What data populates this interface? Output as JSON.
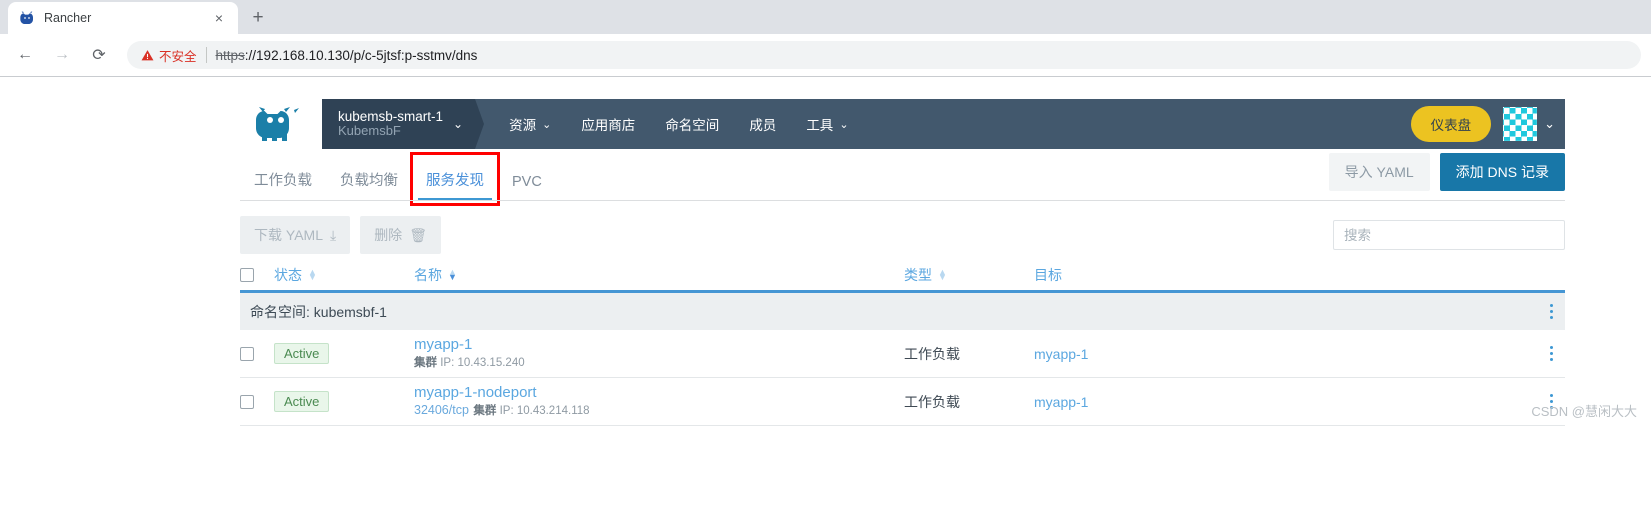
{
  "browser": {
    "tab": {
      "title": "Rancher",
      "favicon": "rancher-cow-icon",
      "close": "×"
    },
    "new_tab": "+",
    "back": "←",
    "forward": "→",
    "reload": "⟳",
    "security": {
      "icon": "warning-triangle-icon",
      "label": "不安全"
    },
    "url": {
      "scheme": "https",
      "rest": "://192.168.10.130/p/c-5jtsf:p-sstmv/dns"
    }
  },
  "header": {
    "logo": "rancher-logo-icon",
    "cluster": {
      "name": "kubemsb-smart-1",
      "project": "KubemsbF",
      "chevron": "⌄"
    },
    "nav": [
      {
        "label": "资源",
        "chevron": "⌄"
      },
      {
        "label": "应用商店",
        "chevron": ""
      },
      {
        "label": "命名空间",
        "chevron": ""
      },
      {
        "label": "成员",
        "chevron": ""
      },
      {
        "label": "工具",
        "chevron": "⌄"
      }
    ],
    "dashboard_button": "仪表盘",
    "avatar": "user-avatar-icon",
    "avatar_chevron": "⌄"
  },
  "page_tabs": [
    {
      "label": "工作负载",
      "active": false,
      "boxed": false
    },
    {
      "label": "负载均衡",
      "active": false,
      "boxed": false
    },
    {
      "label": "服务发现",
      "active": true,
      "boxed": true
    },
    {
      "label": "PVC",
      "active": false,
      "boxed": false
    }
  ],
  "page_actions": {
    "import_yaml": "导入 YAML",
    "add_dns": "添加 DNS 记录"
  },
  "table_toolbar": {
    "download_yaml": "下载 YAML",
    "download_icon": "⤓",
    "delete": "删除",
    "delete_icon": "🗑",
    "search_placeholder": "搜索",
    "search_value": ""
  },
  "table": {
    "columns": [
      {
        "key": "state",
        "label": "状态",
        "sortable": true
      },
      {
        "key": "name",
        "label": "名称",
        "sortable": true,
        "sorted": true
      },
      {
        "key": "type",
        "label": "类型",
        "sortable": true
      },
      {
        "key": "target",
        "label": "目标",
        "sortable": false
      }
    ],
    "group": {
      "prefix": "命名空间",
      "value": "kubemsbf-1",
      "menu": "kebab-menu-icon"
    },
    "rows": [
      {
        "state": "Active",
        "name": "myapp-1",
        "port": "",
        "sub_label": "集群",
        "sub_value": "IP: 10.43.15.240",
        "type": "工作负载",
        "target": "myapp-1",
        "menu": "kebab-menu-icon"
      },
      {
        "state": "Active",
        "name": "myapp-1-nodeport",
        "port": "32406/tcp",
        "sub_label": "集群",
        "sub_value": "IP: 10.43.214.118",
        "type": "工作负载",
        "target": "myapp-1",
        "menu": "kebab-menu-icon"
      }
    ]
  },
  "watermark": "CSDN @慧闲大大",
  "colors": {
    "header_bg": "#42586d",
    "cluster_bg": "#2f4255",
    "accent_blue": "#3d98d3",
    "link_blue": "#5ba7e0",
    "primary_btn": "#1877a8",
    "dashboard_yellow": "#ecc321",
    "annotation_red": "#ff0000",
    "badge_green": "#4a8a51"
  }
}
